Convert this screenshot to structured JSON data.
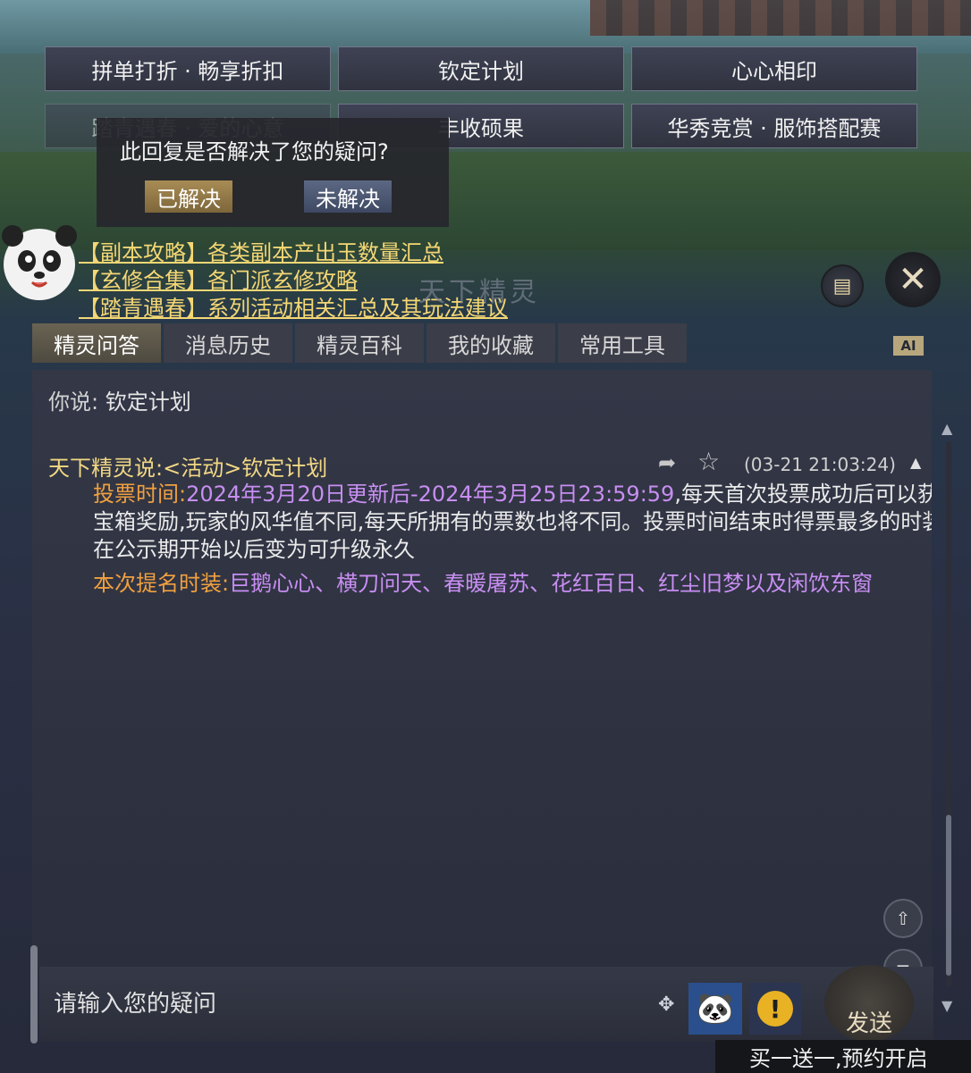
{
  "top_buttons": [
    "拼单打折 · 畅享折扣",
    "钦定计划",
    "心心相印",
    "踏青遇春 · 爱的心意",
    "丰收硕果",
    "华秀竞赏 · 服饰搭配赛"
  ],
  "popup": {
    "question": "此回复是否解决了您的疑问?",
    "yes": "已解决",
    "no": "未解决"
  },
  "links": [
    "【副本攻略】各类副本产出玉数量汇总",
    "【玄修合集】各门派玄修攻略",
    "【踏青遇春】系列活动相关汇总及其玩法建议"
  ],
  "watermark": "天下精灵",
  "tabs": [
    "精灵问答",
    "消息历史",
    "精灵百科",
    "我的收藏",
    "常用工具"
  ],
  "ai_badge": "AI",
  "user_message": {
    "prefix": "你说:",
    "text": "钦定计划"
  },
  "reply": {
    "header": "天下精灵说:<活动>钦定计划",
    "timestamp": "(03-21 21:03:24)",
    "vote_label": "投票时间:",
    "vote_range": "2024年3月20日更新后-2024年3月25日23:59:59",
    "vote_text": ",每天首次投票成功后可以获得宝箱奖励,玩家的风华值不同,每天所拥有的票数也将不同。投票时间结束时得票最多的时装将在公示期开始以后变为可升级永久",
    "nominee_label": "本次提名时装:",
    "nominees": "巨鹅心心、横刀问天、春暖屠苏、花红百日、红尘旧梦以及闲饮东窗"
  },
  "input": {
    "placeholder": "请输入您的疑问"
  },
  "send_label": "发送",
  "promo": "买一送一,预约开启"
}
